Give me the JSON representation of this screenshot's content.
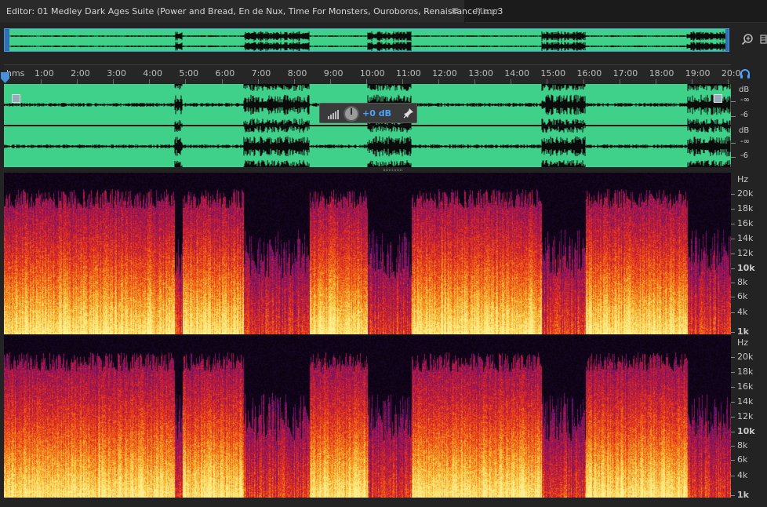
{
  "tabs": {
    "editor_label": "Editor: 01 Medley Dark Ages Suite (Power and Bread, En de Nux, Time For Monsters, Ouroboros, Renaissance).mp3",
    "menu_glyph": "≡",
    "mixer_label": "Mixer"
  },
  "ruler": {
    "unit": "hms",
    "labels": [
      "1:00",
      "2:00",
      "3:00",
      "4:00",
      "5:00",
      "6:00",
      "7:00",
      "8:00",
      "9:00",
      "10:00",
      "11:00",
      "12:00",
      "13:00",
      "14:00",
      "15:00",
      "16:00",
      "17:00",
      "18:00",
      "19:00",
      "20:0"
    ]
  },
  "gain": {
    "value": "+0 dB"
  },
  "db_scale": {
    "unit": "dB",
    "neg_inf": "-∞",
    "minus6": "-6"
  },
  "hz_scale": {
    "unit": "Hz",
    "labels": [
      "20k",
      "18k",
      "16k",
      "14k",
      "12k",
      "10k",
      "8k",
      "6k",
      "4k",
      "1k"
    ]
  },
  "colors": {
    "waveform": "#3fd18a",
    "spectrogram_low": "#ffe066",
    "spectrogram_mid": "#e0301e",
    "spectrogram_high": "#5a1a6e",
    "accent": "#4aa3ff"
  },
  "icons": {
    "zoom": "magnifier-zoom-icon",
    "headphones": "headphone-icon",
    "pin": "pin-icon",
    "levels": "level-bars-icon"
  }
}
